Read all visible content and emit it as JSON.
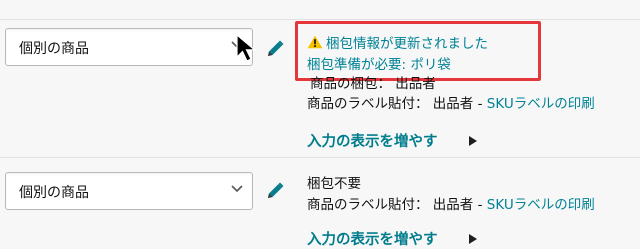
{
  "rows": [
    {
      "select_value": "個別の商品",
      "alert": "梱包情報が更新されました",
      "prep_required": "梱包準備が必要: ポリ袋",
      "packaging_label": "商品の梱包：",
      "packaging_value": "出品者",
      "label_line_prefix": "商品のラベル貼付：",
      "label_line_value": "出品者",
      "label_line_sep": " - ",
      "label_link": "SKUラベルの印刷",
      "more_link": "入力の表示を増やす"
    },
    {
      "select_value": "個別の商品",
      "prep_none": "梱包不要",
      "label_line_prefix": "商品のラベル貼付：",
      "label_line_value": "出品者",
      "label_line_sep": " - ",
      "label_link": "SKUラベルの印刷",
      "more_link": "入力の表示を増やす"
    }
  ],
  "colors": {
    "link": "#008296",
    "warning": "#f3c300",
    "highlight_box": "#e5373b"
  },
  "icons": [
    "warning-icon",
    "pencil-icon",
    "chevron-down-icon",
    "caret-right-icon",
    "mouse-cursor-icon"
  ]
}
